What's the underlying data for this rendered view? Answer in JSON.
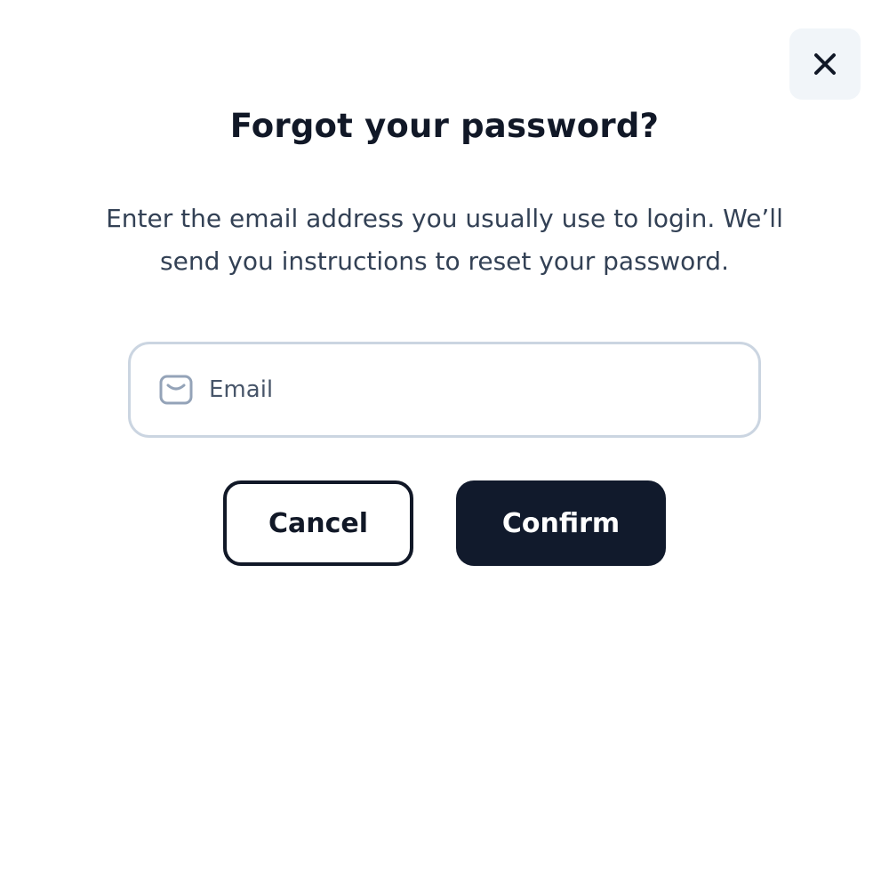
{
  "dialog": {
    "title": "Forgot your password?",
    "description": "Enter the email address you usually use to login. We’ll send you instructions to reset your password.",
    "close_icon": "close-icon"
  },
  "email": {
    "placeholder": "Email",
    "value": "",
    "icon": "mail-icon"
  },
  "actions": {
    "cancel_label": "Cancel",
    "confirm_label": "Confirm"
  },
  "colors": {
    "primary": "#111a2c",
    "text": "#111827",
    "muted_text": "#334155",
    "border": "#cbd5e1",
    "close_bg": "#f1f5f9"
  }
}
